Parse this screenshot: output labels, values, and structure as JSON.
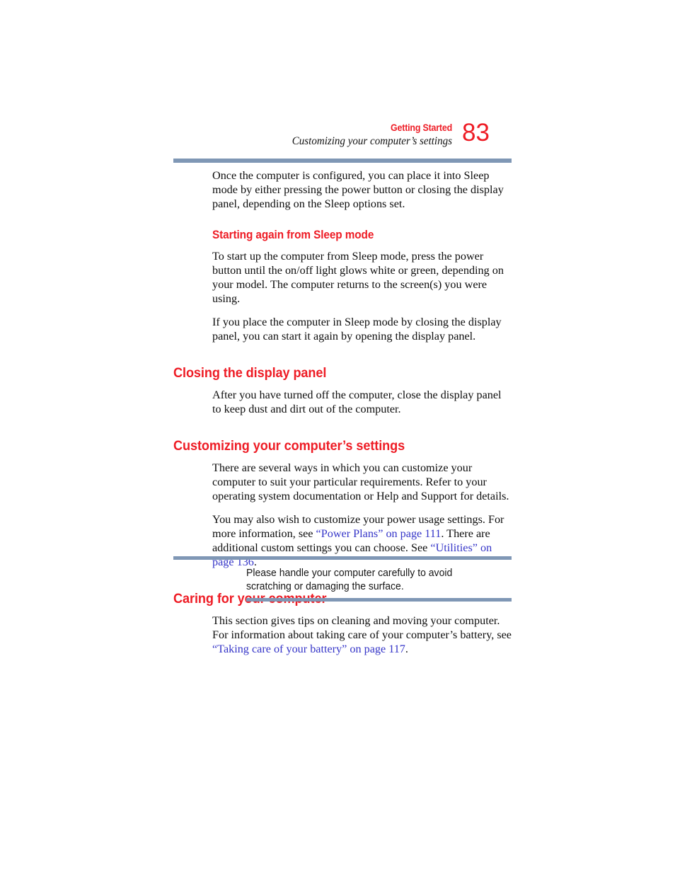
{
  "document": {
    "page_number": "83",
    "header": {
      "chapter": "Getting Started",
      "section": "Customizing your computer’s settings"
    },
    "accent_red": "#ee1c25",
    "rule_blue": "#7f97b5",
    "link_blue": "#3535c8"
  },
  "body": {
    "para_sleep_mode": "Once the computer is configured, you can place it into Sleep mode by either pressing the power button or closing the display panel, depending on the Sleep options set.",
    "heading_starting_again": "Starting again from Sleep mode",
    "para_start_up": "To start up the computer from Sleep mode, press the power button until the on/off light glows white or green, depending on your model. The computer returns to the screen(s) you were using.",
    "para_place_computer": "If you place the computer in Sleep mode by closing the display panel, you can start it again by opening the display panel.",
    "heading_closing_panel": "Closing the display panel",
    "para_after_turned_off": "After you have turned off the computer, close the display panel to keep dust and dirt out of the computer.",
    "heading_customizing": "Customizing your computer’s settings",
    "para_several_ways": "There are several ways in which you can customize your computer to suit your particular requirements. Refer to your operating system documentation or Help and Support for details.",
    "para_power_usage": {
      "seg1": "You may also wish to customize your power usage settings. For more information, see ",
      "link1": "“Power Plans” on page 111",
      "seg2": ". There are additional custom settings you can choose. See ",
      "link2": "“Utilities” on page 136",
      "seg3": "."
    },
    "heading_caring": "Caring for your computer",
    "para_caring": {
      "seg1": "This section gives tips on cleaning and moving your computer. For information about taking care of your computer’s battery, see ",
      "link1": "“Taking care of your battery” on page 117",
      "seg2": "."
    }
  },
  "callout": {
    "text": "Please handle your computer carefully to avoid scratching or damaging the surface."
  }
}
